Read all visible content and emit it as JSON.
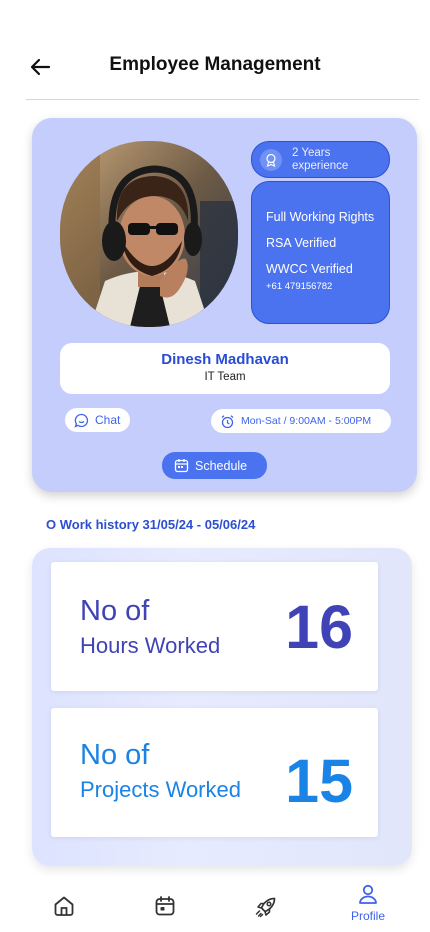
{
  "header": {
    "title": "Employee Management"
  },
  "profile": {
    "experience_line1": "2 Years",
    "experience_line2": "experience",
    "rights": [
      "Full Working Rights",
      "RSA Verified",
      "WWCC Verified",
      "+61 479156782"
    ],
    "name": "Dinesh Madhavan",
    "team": "IT Team",
    "chat_label": "Chat",
    "hours": "Mon-Sat / 9:00AM - 5:00PM",
    "schedule_label": "Schedule"
  },
  "work_history": {
    "title": "O Work history  31/05/24 - 05/06/24",
    "stats": [
      {
        "line1": "No of",
        "line2": "Hours Worked",
        "value": "16"
      },
      {
        "line1": "No of",
        "line2": "Projects Worked",
        "value": "15"
      }
    ]
  },
  "nav": {
    "items": [
      {
        "icon": "home-icon"
      },
      {
        "icon": "calendar-icon"
      },
      {
        "icon": "rocket-icon"
      },
      {
        "icon": "profile-icon",
        "label": "Profile",
        "active": true
      }
    ]
  },
  "colors": {
    "accent": "#4b73ef",
    "card_bg": "#c4cdfb",
    "hours_color": "#4043b5",
    "projects_color": "#1a83e6"
  }
}
